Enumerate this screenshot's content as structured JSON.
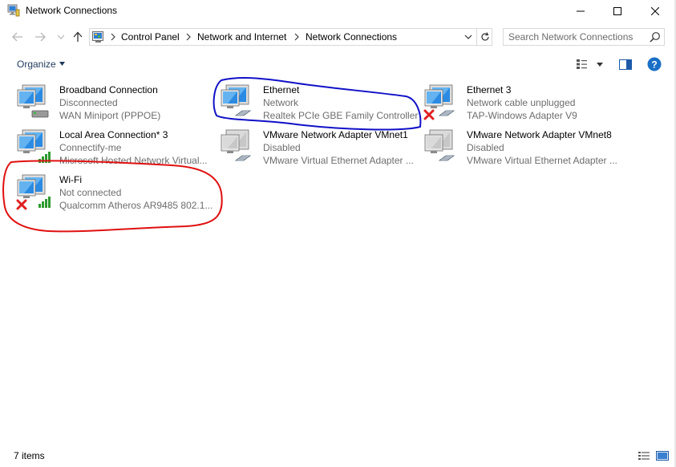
{
  "window": {
    "title": "Network Connections"
  },
  "address": {
    "crumbs": [
      "Control Panel",
      "Network and Internet",
      "Network Connections"
    ]
  },
  "search": {
    "placeholder": "Search Network Connections"
  },
  "toolbar": {
    "organize_label": "Organize"
  },
  "connections": [
    {
      "name": "Broadband Connection",
      "status": "Disconnected",
      "device": "WAN Miniport (PPPOE)",
      "icon": "modem-connection-icon",
      "overlay": "none"
    },
    {
      "name": "Ethernet",
      "status": "Network",
      "device": "Realtek PCIe GBE Family Controller",
      "icon": "ethernet-connection-icon",
      "overlay": "none"
    },
    {
      "name": "Ethernet 3",
      "status": "Network cable unplugged",
      "device": "TAP-Windows Adapter V9",
      "icon": "ethernet-connection-icon",
      "overlay": "red-x"
    },
    {
      "name": "Local Area Connection* 3",
      "status": "Connectify-me",
      "device": "Microsoft Hosted Network Virtual...",
      "icon": "wifi-connection-icon",
      "overlay": "none"
    },
    {
      "name": "VMware Network Adapter VMnet1",
      "status": "Disabled",
      "device": "VMware Virtual Ethernet Adapter ...",
      "icon": "ethernet-connection-icon",
      "overlay": "disabled"
    },
    {
      "name": "VMware Network Adapter VMnet8",
      "status": "Disabled",
      "device": "VMware Virtual Ethernet Adapter ...",
      "icon": "ethernet-connection-icon",
      "overlay": "disabled"
    },
    {
      "name": "Wi-Fi",
      "status": "Not connected",
      "device": "Qualcomm Atheros AR9485 802.1...",
      "icon": "wifi-connection-icon",
      "overlay": "red-x"
    }
  ],
  "statusbar": {
    "count": "7 items"
  },
  "colors": {
    "annotation_blue": "#1010c8",
    "annotation_red": "#e01010",
    "secondary_text": "#6d6d6d",
    "help_blue": "#1a6fc6",
    "error_red": "#e02020"
  }
}
